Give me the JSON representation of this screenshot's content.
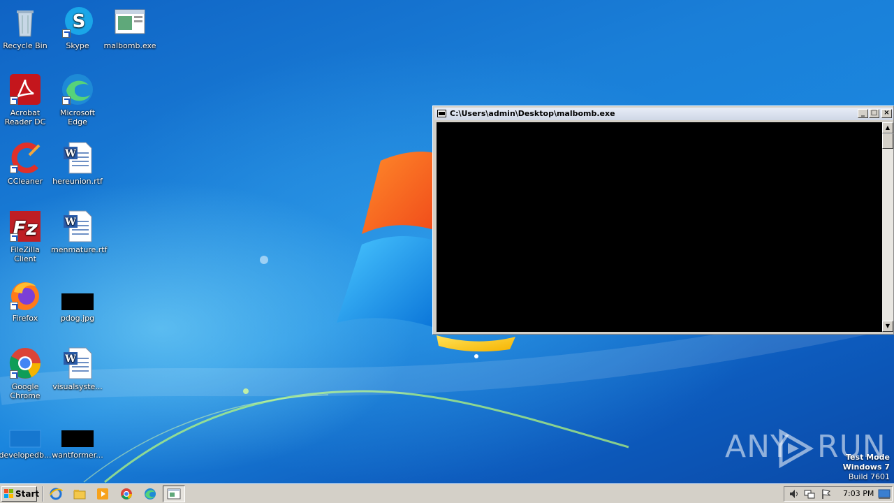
{
  "desktop": {
    "icons": [
      {
        "label": "Recycle Bin"
      },
      {
        "label": "Skype"
      },
      {
        "label": "malbomb.exe"
      },
      {
        "label": "Acrobat Reader DC"
      },
      {
        "label": "Microsoft Edge"
      },
      {
        "label": "CCleaner"
      },
      {
        "label": "hereunion.rtf"
      },
      {
        "label": "FileZilla Client"
      },
      {
        "label": "menmature.rtf"
      },
      {
        "label": "Firefox"
      },
      {
        "label": "pdog.jpg"
      },
      {
        "label": "Google Chrome"
      },
      {
        "label": "visualsyste..."
      },
      {
        "label": "developedb..."
      },
      {
        "label": "wantformer..."
      }
    ]
  },
  "console": {
    "title": "C:\\Users\\admin\\Desktop\\malbomb.exe",
    "minimize": "_",
    "maximize": "□",
    "close": "×",
    "scroll_up": "▲",
    "scroll_down": "▼"
  },
  "watermark": {
    "left": "ANY",
    "right": "RUN"
  },
  "system": {
    "test_mode": "Test Mode",
    "os_name": "Windows 7",
    "build": "Build 7601"
  },
  "taskbar": {
    "start_label": "Start",
    "clock": "7:03 PM"
  },
  "colors": {
    "desktop_blue": "#1a7fd8",
    "taskbar": "#d4d0c8",
    "console_bg": "#000000"
  }
}
